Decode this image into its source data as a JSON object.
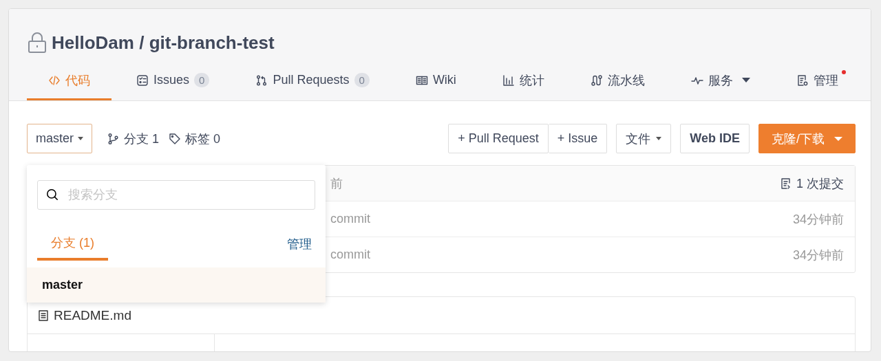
{
  "repo": {
    "private": true,
    "owner": "HelloDam",
    "separator": "/",
    "name": "git-branch-test"
  },
  "tabs": [
    {
      "label": "代码",
      "selected": true,
      "dropdown": false,
      "notification": false
    },
    {
      "label": "Issues",
      "count": "0",
      "selected": false,
      "dropdown": false,
      "notification": false
    },
    {
      "label": "Pull Requests",
      "count": "0",
      "selected": false,
      "dropdown": false,
      "notification": false
    },
    {
      "label": "Wiki",
      "selected": false,
      "dropdown": false,
      "notification": false
    },
    {
      "label": "统计",
      "selected": false,
      "dropdown": false,
      "notification": false
    },
    {
      "label": "流水线",
      "selected": false,
      "dropdown": false,
      "notification": false
    },
    {
      "label": "服务",
      "selected": false,
      "dropdown": true,
      "notification": false
    },
    {
      "label": "管理",
      "selected": false,
      "dropdown": false,
      "notification": true
    }
  ],
  "toolbar": {
    "branch_selector": {
      "label": "master",
      "open": true
    },
    "branch_count": "分支 1",
    "tag_count": "标签 0",
    "new_buttons": [
      "+ Pull Request",
      "+ Issue"
    ],
    "file_menu": "文件",
    "web_ide": "Web IDE",
    "clone": "克隆/下载"
  },
  "branch_dropdown": {
    "search": {
      "placeholder": "搜索分支"
    },
    "tab": {
      "label": "分支 (1)",
      "selected": true
    },
    "manage": "管理",
    "branches": [
      {
        "name": "master",
        "selected": true
      }
    ]
  },
  "commits": {
    "header": {
      "time": "前",
      "commit_count": "1 次提交"
    },
    "rows": [
      {
        "message": "commit",
        "time": "34分钟前"
      },
      {
        "message": "commit",
        "time": "34分钟前"
      }
    ]
  },
  "readme": {
    "filename": "README.md"
  }
}
